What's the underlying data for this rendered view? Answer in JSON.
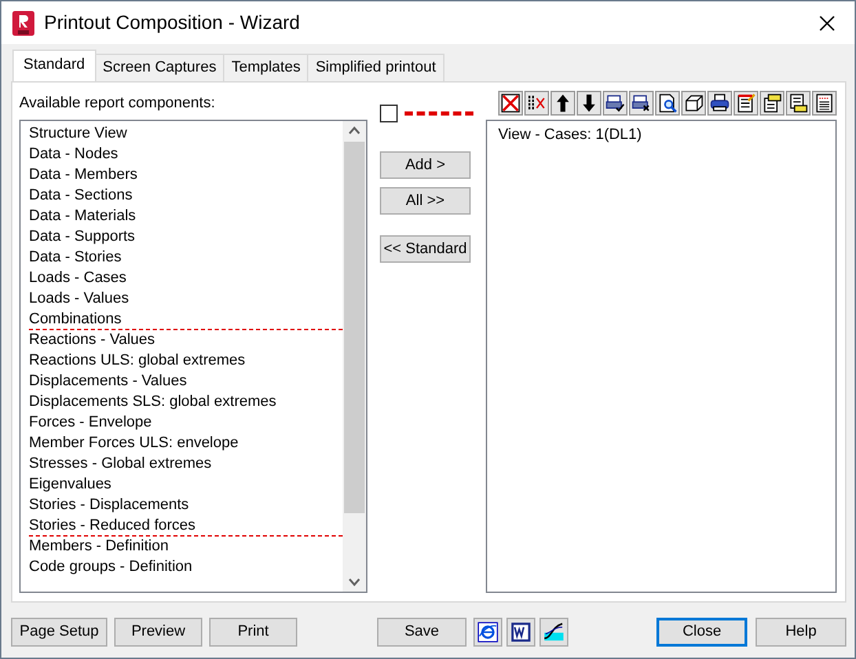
{
  "window": {
    "title": "Printout Composition - Wizard"
  },
  "tabs": [
    {
      "label": "Standard",
      "selected": true
    },
    {
      "label": "Screen Captures",
      "selected": false
    },
    {
      "label": "Templates",
      "selected": false
    },
    {
      "label": "Simplified printout",
      "selected": false
    }
  ],
  "available_label": "Available report components:",
  "components": [
    {
      "label": "Structure View",
      "separator_after": false
    },
    {
      "label": "Data - Nodes",
      "separator_after": false
    },
    {
      "label": "Data - Members",
      "separator_after": false
    },
    {
      "label": "Data - Sections",
      "separator_after": false
    },
    {
      "label": "Data - Materials",
      "separator_after": false
    },
    {
      "label": "Data - Supports",
      "separator_after": false
    },
    {
      "label": "Data - Stories",
      "separator_after": false
    },
    {
      "label": "Loads - Cases",
      "separator_after": false
    },
    {
      "label": "Loads - Values",
      "separator_after": false
    },
    {
      "label": "Combinations",
      "separator_after": true
    },
    {
      "label": "Reactions - Values",
      "separator_after": false
    },
    {
      "label": "Reactions ULS: global extremes",
      "separator_after": false
    },
    {
      "label": "Displacements - Values",
      "separator_after": false
    },
    {
      "label": "Displacements SLS: global extremes",
      "separator_after": false
    },
    {
      "label": "Forces - Envelope",
      "separator_after": false
    },
    {
      "label": "Member Forces ULS: envelope",
      "separator_after": false
    },
    {
      "label": "Stresses - Global extremes",
      "separator_after": false
    },
    {
      "label": "Eigenvalues",
      "separator_after": false
    },
    {
      "label": "Stories - Displacements",
      "separator_after": false
    },
    {
      "label": "Stories - Reduced forces",
      "separator_after": true
    },
    {
      "label": "Members - Definition",
      "separator_after": false
    },
    {
      "label": "Code groups - Definition",
      "separator_after": false
    }
  ],
  "separator_legend": {
    "checked": false
  },
  "transfer_buttons": [
    "Add >",
    "All >>",
    "<< Standard"
  ],
  "report_items": [
    "View - Cases: 1(DL1)"
  ],
  "footer_left": [
    "Page Setup",
    "Preview",
    "Print"
  ],
  "save": "Save",
  "footer_right": [
    {
      "label": "Close",
      "default": true
    },
    {
      "label": "Help",
      "default": false
    }
  ]
}
